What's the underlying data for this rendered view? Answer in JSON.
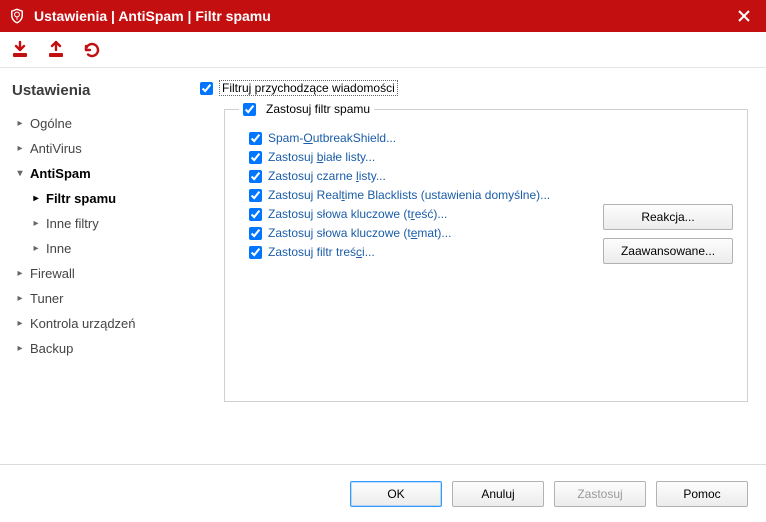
{
  "window": {
    "title": "Ustawienia | AntiSpam | Filtr spamu"
  },
  "sidebar": {
    "heading": "Ustawienia",
    "items": [
      {
        "label": "Ogólne",
        "level": 0,
        "active": false,
        "expand": "right"
      },
      {
        "label": "AntiVirus",
        "level": 0,
        "active": false,
        "expand": "right"
      },
      {
        "label": "AntiSpam",
        "level": 0,
        "active": true,
        "expand": "down"
      },
      {
        "label": "Filtr spamu",
        "level": 1,
        "active": true,
        "expand": "right"
      },
      {
        "label": "Inne filtry",
        "level": 1,
        "active": false,
        "expand": "right"
      },
      {
        "label": "Inne",
        "level": 1,
        "active": false,
        "expand": "right"
      },
      {
        "label": "Firewall",
        "level": 0,
        "active": false,
        "expand": "right"
      },
      {
        "label": "Tuner",
        "level": 0,
        "active": false,
        "expand": "right"
      },
      {
        "label": "Kontrola urządzeń",
        "level": 0,
        "active": false,
        "expand": "right"
      },
      {
        "label": "Backup",
        "level": 0,
        "active": false,
        "expand": "right"
      }
    ]
  },
  "main": {
    "filter_incoming": "Filtruj przychodzące wiadomości",
    "apply_spam_filter": "Zastosuj filtr spamu",
    "options": {
      "outbreak": {
        "pre": "Spam-",
        "u": "O",
        "post": "utbreakShield..."
      },
      "white": {
        "pre": "Zastosuj ",
        "u": "b",
        "post": "iałe listy..."
      },
      "black": {
        "pre": "Zastosuj czarne ",
        "u": "l",
        "post": "isty..."
      },
      "rtbl": {
        "pre": "Zastosuj Real",
        "u": "t",
        "post": "ime Blacklists (ustawienia domyślne)..."
      },
      "kw_body": {
        "pre": "Zastosuj słowa kluczowe (t",
        "u": "r",
        "post": "eść)..."
      },
      "kw_subj": {
        "pre": "Zastosuj słowa kluczowe (t",
        "u": "e",
        "post": "mat)..."
      },
      "content": {
        "pre": "Zastosuj filtr treś",
        "u": "c",
        "post": "i..."
      }
    },
    "buttons": {
      "reaction": {
        "pre": "R",
        "u": "e",
        "post": "akcja..."
      },
      "advanced": {
        "pre": "Zaa",
        "u": "w",
        "post": "ansowane..."
      }
    }
  },
  "footer": {
    "ok": "OK",
    "cancel": "Anuluj",
    "apply": "Zastosuj",
    "help": "Pomoc"
  }
}
